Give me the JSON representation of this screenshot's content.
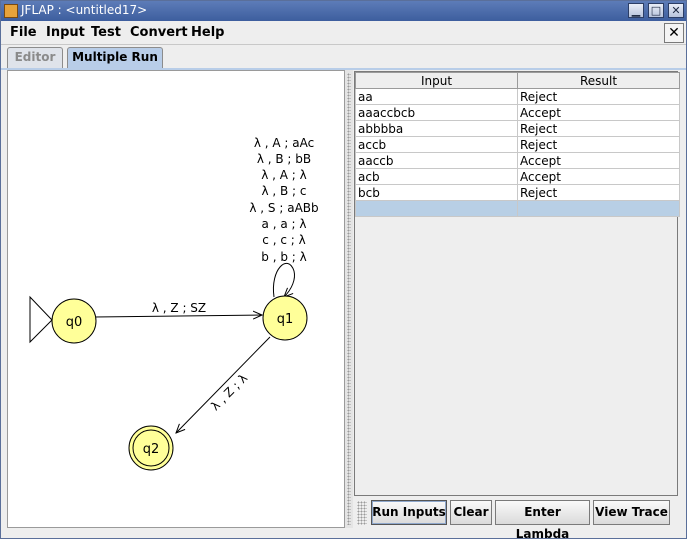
{
  "window": {
    "title": "JFLAP : <untitled17>"
  },
  "menu": {
    "file": "File",
    "input": "Input",
    "test": "Test",
    "convert": "Convert",
    "help": "Help"
  },
  "tabs": {
    "editor": "Editor",
    "multiple_run": "Multiple Run"
  },
  "automaton": {
    "states": {
      "q0": "q0",
      "q1": "q1",
      "q2": "q2"
    },
    "edge_q0_q1": "λ , Z ; SZ",
    "edge_q1_q2": "λ , Z ; λ",
    "loop_q1": [
      "λ , A ; aAc",
      "λ , B ; bB",
      "λ , A ; λ",
      "λ , B ; c",
      "λ , S ; aABb",
      "a , a ; λ",
      "c , c ; λ",
      "b , b ; λ"
    ]
  },
  "table": {
    "headers": {
      "input": "Input",
      "result": "Result"
    },
    "rows": [
      {
        "input": "aa",
        "result": "Reject"
      },
      {
        "input": "aaaccbcb",
        "result": "Accept"
      },
      {
        "input": "abbbba",
        "result": "Reject"
      },
      {
        "input": "accb",
        "result": "Reject"
      },
      {
        "input": "aaccb",
        "result": "Accept"
      },
      {
        "input": "acb",
        "result": "Accept"
      },
      {
        "input": "bcb",
        "result": "Reject"
      },
      {
        "input": "",
        "result": ""
      }
    ]
  },
  "buttons": {
    "run_inputs": "Run Inputs",
    "clear": "Clear",
    "enter_lambda": "Enter Lambda",
    "view_trace": "View Trace"
  },
  "colors": {
    "state_fill": "#ffff99",
    "title_bar": "#4a6aa8",
    "selected_row": "#b8cfe5"
  }
}
